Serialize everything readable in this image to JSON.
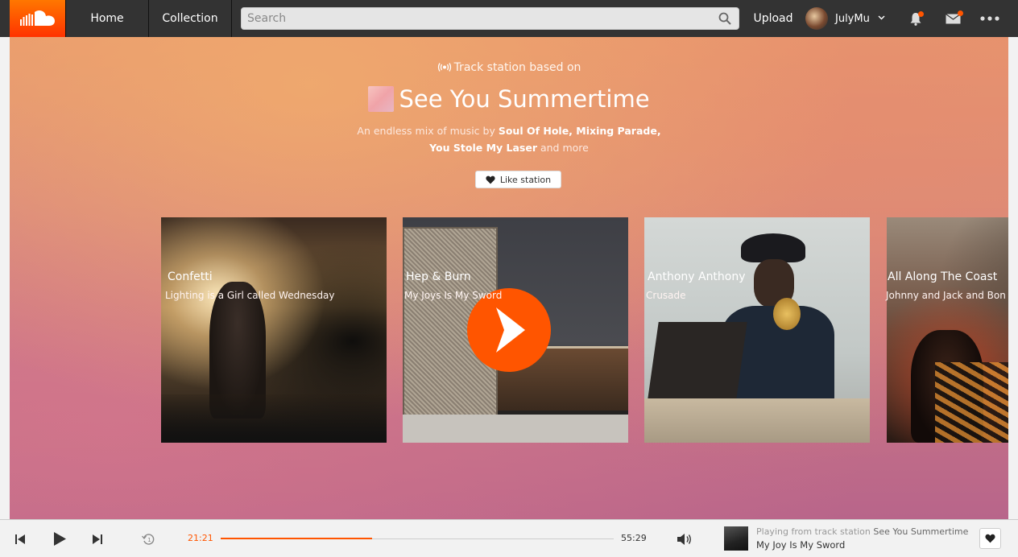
{
  "header": {
    "logo_icon": "soundcloud-cloud-icon",
    "nav": {
      "home": "Home",
      "collection": "Collection"
    },
    "search": {
      "placeholder": "Search",
      "value": ""
    },
    "upload": "Upload",
    "user": {
      "name": "JulyMu",
      "caret_icon": "chevron-down-icon"
    },
    "icons": [
      "bell-icon",
      "mail-icon",
      "more-icon"
    ],
    "accent_color": "#ff5500"
  },
  "station": {
    "label": "Track station based on",
    "title": "See You Summertime",
    "desc_prefix": "An endless mix of music by ",
    "desc_artists": "Soul Of Hole, Mixing Parade, You Stole My Laser",
    "desc_suffix": " and more",
    "like_label": "Like station"
  },
  "tracks": [
    {
      "title": "Confetti",
      "artist": "Lighting is a Girl called Wednesday"
    },
    {
      "title": "Hep & Burn",
      "artist": "My Joys Is My Sword",
      "playing_overlay": true
    },
    {
      "title": "Anthony Anthony",
      "artist": "Crusade"
    },
    {
      "title": "All Along The Coast",
      "artist": "Johnny and Jack and Bon"
    }
  ],
  "player": {
    "current_time": "21:21",
    "total_time": "55:29",
    "progress": 0.385,
    "context_prefix": "Playing from track station",
    "context_name": "See You Summertime",
    "track": "My Joy Is My Sword"
  }
}
